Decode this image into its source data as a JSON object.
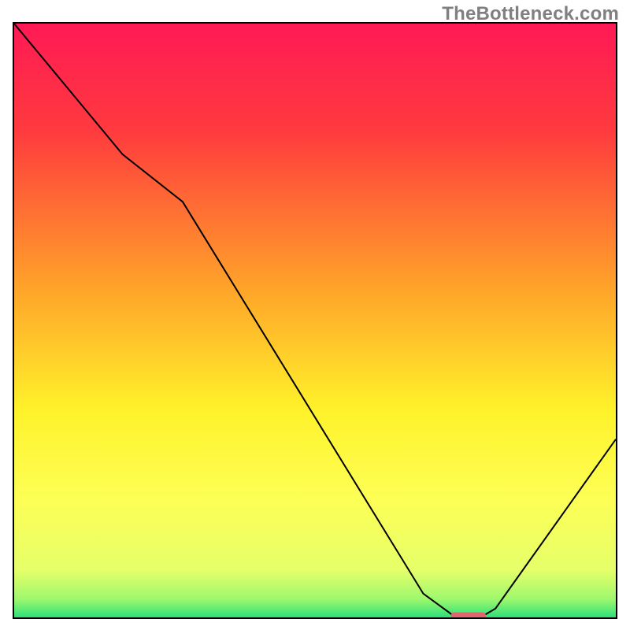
{
  "watermark": "TheBottleneck.com",
  "chart_data": {
    "type": "line",
    "title": "",
    "xlabel": "",
    "ylabel": "",
    "xlim": [
      0,
      100
    ],
    "ylim": [
      0,
      100
    ],
    "x": [
      0,
      18,
      28,
      68,
      73,
      78,
      80,
      100
    ],
    "values": [
      100,
      78,
      70,
      4,
      0.3,
      0.3,
      1.5,
      30
    ],
    "optimal_marker": {
      "x_start": 73,
      "x_end": 78,
      "y": 0.3
    },
    "background": {
      "type": "vertical-gradient",
      "stops": [
        {
          "offset": 0.0,
          "color": "#ff1a55"
        },
        {
          "offset": 0.18,
          "color": "#ff3a3e"
        },
        {
          "offset": 0.45,
          "color": "#ffa529"
        },
        {
          "offset": 0.65,
          "color": "#fff22a"
        },
        {
          "offset": 0.8,
          "color": "#fdff55"
        },
        {
          "offset": 0.92,
          "color": "#e6ff6a"
        },
        {
          "offset": 0.97,
          "color": "#9cf86d"
        },
        {
          "offset": 1.0,
          "color": "#2de07a"
        }
      ]
    }
  }
}
